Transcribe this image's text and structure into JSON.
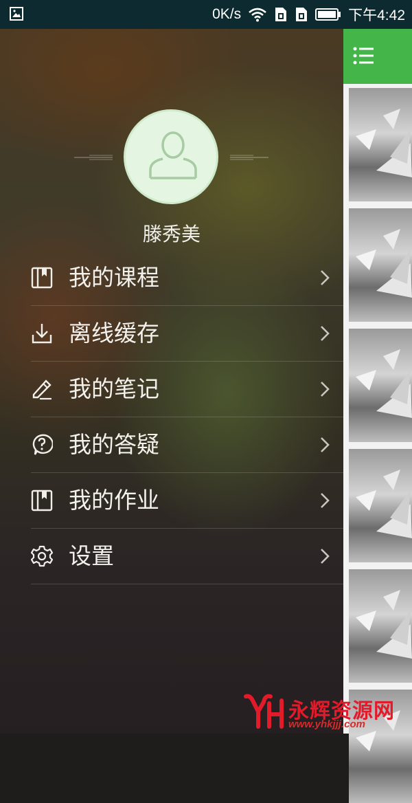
{
  "status_bar": {
    "left_icon": "image-icon",
    "speed": "0K/s",
    "time": "下午4:42",
    "icons": [
      "wifi-icon",
      "sim-card-icon",
      "sim-card-icon",
      "battery-icon"
    ]
  },
  "drawer": {
    "user_name": "滕秀美",
    "avatar_icon": "user-avatar-icon",
    "menu": [
      {
        "label": "我的课程",
        "icon": "book-icon"
      },
      {
        "label": "离线缓存",
        "icon": "download-icon"
      },
      {
        "label": "我的笔记",
        "icon": "pencil-icon"
      },
      {
        "label": "我的答疑",
        "icon": "question-icon"
      },
      {
        "label": "我的作业",
        "icon": "book-icon"
      },
      {
        "label": "设置",
        "icon": "gear-icon"
      }
    ]
  },
  "background_app": {
    "menu_icon": "list-icon",
    "accent_color": "#44b548"
  },
  "watermark": {
    "brand": "永辉资源网",
    "url": "www.yhkjjj.com"
  }
}
